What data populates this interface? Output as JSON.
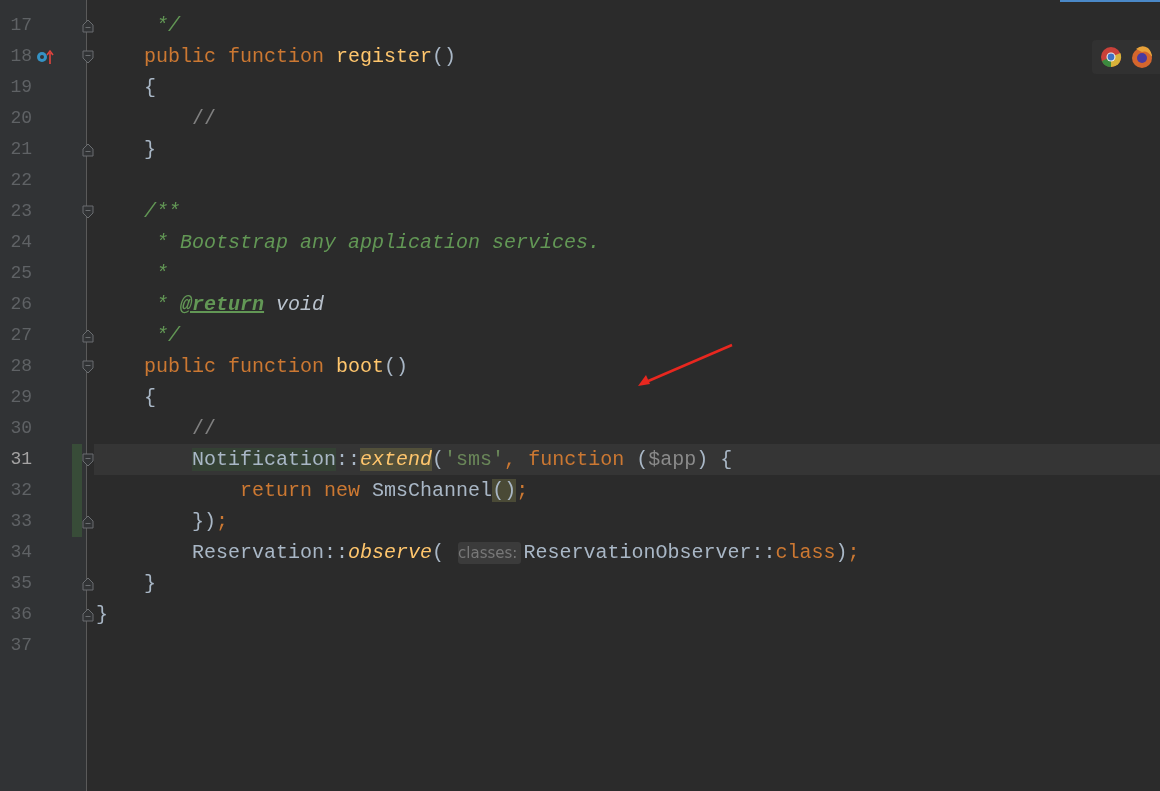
{
  "lines": [
    {
      "number": "17",
      "fold_start": false,
      "fold_end": true,
      "overrides": false,
      "changed": false,
      "current": false,
      "tokens": [
        {
          "kind": "doc",
          "text": "     */"
        }
      ]
    },
    {
      "number": "18",
      "fold_start": true,
      "fold_end": false,
      "overrides": true,
      "changed": false,
      "current": false,
      "tokens": [
        {
          "kind": "keyword",
          "text": "    public"
        },
        {
          "kind": "keyword",
          "text": " function"
        },
        {
          "kind": "function",
          "text": " register"
        },
        {
          "kind": "plain",
          "text": "()"
        }
      ]
    },
    {
      "number": "19",
      "fold_start": false,
      "fold_end": false,
      "overrides": false,
      "changed": false,
      "current": false,
      "tokens": [
        {
          "kind": "plain",
          "text": "    {"
        }
      ]
    },
    {
      "number": "20",
      "fold_start": false,
      "fold_end": false,
      "overrides": false,
      "changed": false,
      "current": false,
      "tokens": [
        {
          "kind": "comment",
          "text": "        //"
        }
      ]
    },
    {
      "number": "21",
      "fold_start": false,
      "fold_end": true,
      "overrides": false,
      "changed": false,
      "current": false,
      "tokens": [
        {
          "kind": "plain",
          "text": "    }"
        }
      ]
    },
    {
      "number": "22",
      "fold_start": false,
      "fold_end": false,
      "overrides": false,
      "changed": false,
      "current": false
    },
    {
      "number": "23",
      "fold_start": true,
      "fold_end": false,
      "overrides": false,
      "changed": false,
      "current": false,
      "tokens": [
        {
          "kind": "doc",
          "text": "    /**"
        }
      ]
    },
    {
      "number": "24",
      "fold_start": false,
      "fold_end": false,
      "overrides": false,
      "changed": false,
      "current": false,
      "tokens": [
        {
          "kind": "doc",
          "text": "     * Bootstrap any application services."
        }
      ]
    },
    {
      "number": "25",
      "fold_start": false,
      "fold_end": false,
      "overrides": false,
      "changed": false,
      "current": false,
      "tokens": [
        {
          "kind": "doc",
          "text": "     *"
        }
      ]
    },
    {
      "number": "26",
      "fold_start": false,
      "fold_end": false,
      "overrides": false,
      "changed": false,
      "current": false,
      "tokens": [
        {
          "kind": "doc",
          "text": "     *"
        },
        {
          "kind": "doctag",
          "text": " @return"
        },
        {
          "kind": "doctype",
          "text": " void"
        }
      ]
    },
    {
      "number": "27",
      "fold_start": false,
      "fold_end": true,
      "overrides": false,
      "changed": false,
      "current": false,
      "tokens": [
        {
          "kind": "doc",
          "text": "     */"
        }
      ]
    },
    {
      "number": "28",
      "fold_start": true,
      "fold_end": false,
      "overrides": false,
      "changed": false,
      "current": false,
      "tokens": [
        {
          "kind": "keyword",
          "text": "    public"
        },
        {
          "kind": "keyword",
          "text": " function"
        },
        {
          "kind": "function",
          "text": " boot"
        },
        {
          "kind": "plain",
          "text": "()"
        }
      ]
    },
    {
      "number": "29",
      "fold_start": false,
      "fold_end": false,
      "overrides": false,
      "changed": false,
      "current": false,
      "tokens": [
        {
          "kind": "plain",
          "text": "    {"
        }
      ]
    },
    {
      "number": "30",
      "fold_start": false,
      "fold_end": false,
      "overrides": false,
      "changed": false,
      "current": false,
      "tokens": [
        {
          "kind": "comment",
          "text": "        //"
        }
      ]
    },
    {
      "number": "31",
      "fold_start": true,
      "fold_end": false,
      "overrides": false,
      "changed": true,
      "current": true,
      "tokens": [
        {
          "kind": "usage",
          "text": "        Notification"
        },
        {
          "kind": "plain",
          "text": "::"
        },
        {
          "kind": "methodwrite",
          "text": "extend"
        },
        {
          "kind": "plain",
          "text": "("
        },
        {
          "kind": "string",
          "text": "'sms'"
        },
        {
          "kind": "keyword",
          "text": ","
        },
        {
          "kind": "keyword",
          "text": " function"
        },
        {
          "kind": "plain",
          "text": " ("
        },
        {
          "kind": "variable",
          "text": "$app"
        },
        {
          "kind": "plain",
          "text": ")"
        },
        {
          "kind": "plain",
          "text": " {"
        }
      ]
    },
    {
      "number": "32",
      "fold_start": false,
      "fold_end": false,
      "overrides": false,
      "changed": true,
      "current": false,
      "tokens": [
        {
          "kind": "keyword",
          "text": "            return"
        },
        {
          "kind": "keyword",
          "text": " new"
        },
        {
          "kind": "plain",
          "text": " SmsChannel"
        },
        {
          "kind": "bracepair",
          "text": "()"
        },
        {
          "kind": "keyword",
          "text": ";"
        }
      ]
    },
    {
      "number": "33",
      "fold_start": false,
      "fold_end": true,
      "overrides": false,
      "changed": true,
      "current": false,
      "tokens": [
        {
          "kind": "plain",
          "text": "        })"
        },
        {
          "kind": "keyword",
          "text": ";"
        }
      ]
    },
    {
      "number": "34",
      "fold_start": false,
      "fold_end": false,
      "overrides": false,
      "changed": false,
      "current": false,
      "tokens": [
        {
          "kind": "plain",
          "text": "        Reservation::"
        },
        {
          "kind": "method",
          "text": "observe"
        },
        {
          "kind": "plain",
          "text": "("
        },
        {
          "kind": "hint",
          "text": " classes:"
        },
        {
          "kind": "plain",
          "text": "ReservationObserver::"
        },
        {
          "kind": "keyword",
          "text": "class"
        },
        {
          "kind": "plain",
          "text": ")"
        },
        {
          "kind": "keyword",
          "text": ";"
        }
      ]
    },
    {
      "number": "35",
      "fold_start": false,
      "fold_end": true,
      "overrides": false,
      "changed": false,
      "current": false,
      "tokens": [
        {
          "kind": "plain",
          "text": "    }"
        }
      ]
    },
    {
      "number": "36",
      "fold_start": false,
      "fold_end": true,
      "overrides": false,
      "changed": false,
      "current": false,
      "tokens": [
        {
          "kind": "plain",
          "text": "}"
        }
      ]
    },
    {
      "number": "37",
      "fold_start": false,
      "fold_end": false,
      "overrides": false,
      "changed": false,
      "current": false
    }
  ]
}
